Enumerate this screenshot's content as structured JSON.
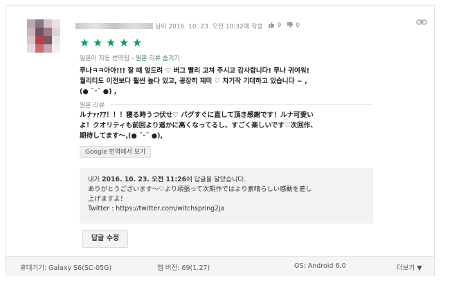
{
  "review": {
    "date_time": "님이 2016. 10. 23. 오전 10:32에 작성",
    "likes": "9",
    "dislikes": "0",
    "stars": [
      "★",
      "★",
      "★",
      "★",
      "★"
    ],
    "auto_translated_prefix": "일본어 자동 번역됨 -",
    "show_original_link": "원본 리뷰 숨기기",
    "translated_lines": [
      "루나ㅋㅋ아아!!! 잘 때 엎드려 ♡ 버그 빨리 고쳐 주시고 감사합니다! 루나 귀여워!",
      "퀄리티도 이전보다 훨씬 높다 있고, 굉장히 재미 ♡ 차기작 기대하고 있습니다 ~ ,",
      "(● ˘ᵕ˘ ●) ,"
    ],
    "original_label": "원본 리뷰",
    "original_lines": [
      "ルナｧｧｱｱ！！！寝る時うつ伏せ♡ バグすぐに直して頂き感謝です！ルナ可愛い",
      "よ！クオリティも前回より遥かに高くなってるし、すごく楽しいです♡次回作、",
      "期待してます～,(● ˘ᵕ˘ ●),"
    ],
    "google_translate_button": "Google 번역에서 보기"
  },
  "reply": {
    "header_prefix": "내가 ",
    "header_date": "2016. 10. 23. 오전 11:26",
    "header_suffix": "에 답글을 달았습니다.",
    "lines": [
      "ありがとうございます～♡より頑張って次期作ではより素晴らしい感動を差し",
      "上げますよ！",
      "Twitter : https://twitter.com/witchspring2ja"
    ],
    "edit_button": "답글 수정"
  },
  "footer": {
    "device": "휴대기기: Galaxy S6(SC-05G)",
    "app_version": "앱 버전: 69(1.27)",
    "os": "OS: Android 6.0",
    "more": "더보기 ▼"
  },
  "icons": {
    "thumb_up": "thumbs-up-icon",
    "thumb_down": "thumbs-down-icon",
    "link": "link-icon",
    "star": "star-icon"
  },
  "colors": {
    "star": "#0e9c58",
    "link": "#3f7f5f"
  }
}
